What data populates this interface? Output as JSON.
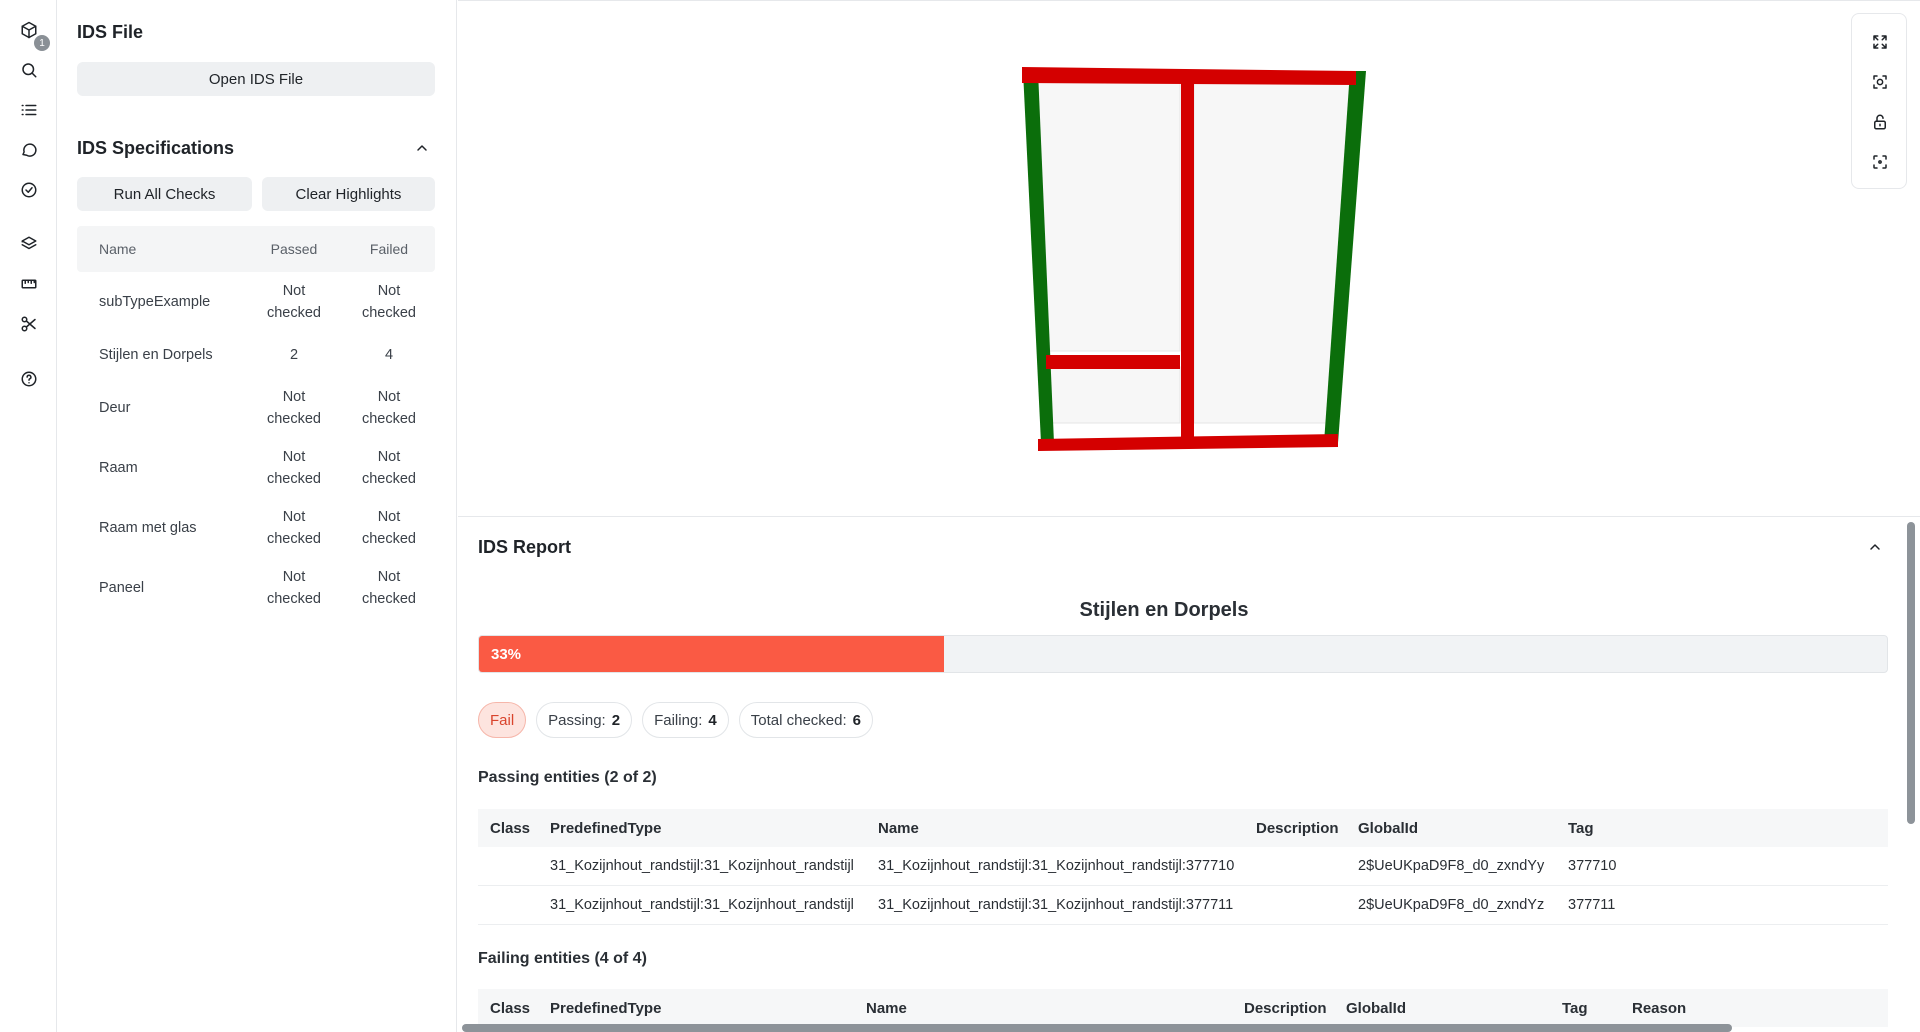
{
  "rail": {
    "badge": "1",
    "icons": [
      "model-icon",
      "search-icon",
      "list-icon",
      "comment-icon",
      "check-circle-icon",
      "layers-icon",
      "measure-icon",
      "scissors-icon",
      "help-icon"
    ]
  },
  "panel": {
    "ids_file_title": "IDS File",
    "open_button": "Open IDS File",
    "specs_title": "IDS Specifications",
    "run_button": "Run All Checks",
    "clear_button": "Clear Highlights",
    "columns": {
      "name": "Name",
      "passed": "Passed",
      "failed": "Failed"
    },
    "rows": [
      {
        "name": "subTypeExample",
        "passed_l1": "Not",
        "passed_l2": "checked",
        "failed_l1": "Not",
        "failed_l2": "checked"
      },
      {
        "name": "Stijlen en Dorpels",
        "passed_l1": "2",
        "passed_l2": "",
        "failed_l1": "4",
        "failed_l2": ""
      },
      {
        "name": "Deur",
        "passed_l1": "Not",
        "passed_l2": "checked",
        "failed_l1": "Not",
        "failed_l2": "checked"
      },
      {
        "name": "Raam",
        "passed_l1": "Not",
        "passed_l2": "checked",
        "failed_l1": "Not",
        "failed_l2": "checked"
      },
      {
        "name": "Raam met glas",
        "passed_l1": "Not",
        "passed_l2": "checked",
        "failed_l1": "Not",
        "failed_l2": "checked"
      },
      {
        "name": "Paneel",
        "passed_l1": "Not",
        "passed_l2": "checked",
        "failed_l1": "Not",
        "failed_l2": "checked"
      }
    ]
  },
  "viewer": {
    "tools": [
      "fullscreen-icon",
      "focus-icon",
      "lock-icon",
      "center-icon"
    ],
    "colors": {
      "pass": "#0b6e0b",
      "fail": "#d40000"
    }
  },
  "report": {
    "title": "IDS Report",
    "spec_name": "Stijlen en Dorpels",
    "progress_value": 33,
    "progress_label": "33%",
    "status": "Fail",
    "passing_label": "Passing:",
    "passing_count": "2",
    "failing_label": "Failing:",
    "failing_count": "4",
    "total_label": "Total checked:",
    "total_count": "6",
    "passing_title": "Passing entities (2 of 2)",
    "passing_columns": [
      "Class",
      "PredefinedType",
      "Name",
      "Description",
      "GlobalId",
      "Tag"
    ],
    "passing_rows": [
      [
        "",
        "31_Kozijnhout_randstijl:31_Kozijnhout_randstijl",
        "31_Kozijnhout_randstijl:31_Kozijnhout_randstijl:377710",
        "",
        "2$UeUKpaD9F8_d0_zxndYy",
        "377710"
      ],
      [
        "",
        "31_Kozijnhout_randstijl:31_Kozijnhout_randstijl",
        "31_Kozijnhout_randstijl:31_Kozijnhout_randstijl:377711",
        "",
        "2$UeUKpaD9F8_d0_zxndYz",
        "377711"
      ]
    ],
    "failing_title": "Failing entities (4 of 4)",
    "failing_columns": [
      "Class",
      "PredefinedType",
      "Name",
      "Description",
      "GlobalId",
      "Tag",
      "Reason"
    ],
    "colors": {
      "accent": "#fa5a44"
    }
  }
}
